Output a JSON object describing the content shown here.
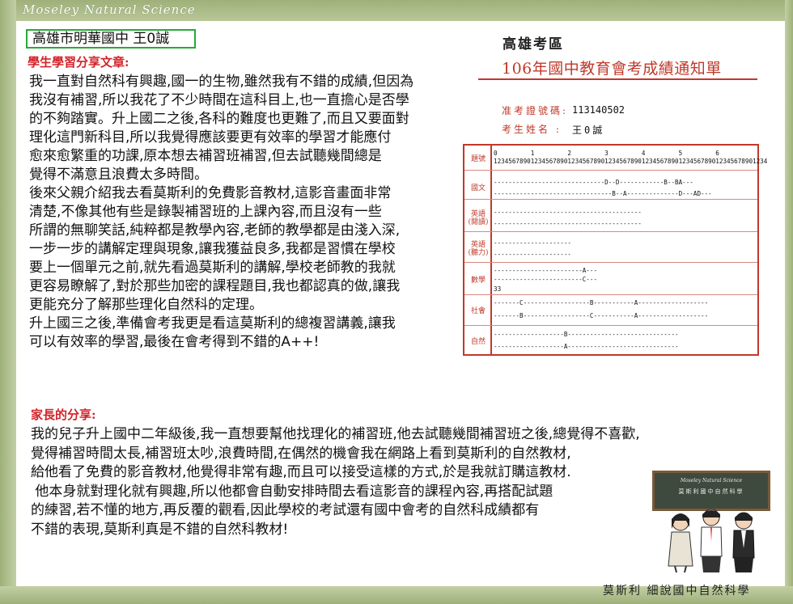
{
  "brand": "Moseley Natural Science",
  "student_name": "高雄市明華國中 王0誠",
  "student_section_title": "學生學習分享文章:",
  "student_text": "我一直對自然科有興趣,國一的生物,雖然我有不錯的成績,但因為\n我沒有補習,所以我花了不少時間在這科目上,也一直擔心是否學\n的不夠踏實。升上國二之後,各科的難度也更難了,而且又要面對\n理化這門新科目,所以我覺得應該要更有效率的學習才能應付\n愈來愈繁重的功課,原本想去補習班補習,但去試聽幾間總是\n覺得不滿意且浪費太多時間。\n後來父親介紹我去看莫斯利的免費影音教材,這影音畫面非常\n清楚,不像其他有些是錄製補習班的上課內容,而且沒有一些\n所謂的無聊笑話,純粹都是教學內容,老師的教學都是由淺入深,\n一步一步的講解定理與現象,讓我獲益良多,我都是習慣在學校\n要上一個單元之前,就先看過莫斯利的講解,學校老師教的我就\n更容易瞭解了,對於那些加密的課程題目,我也都認真的做,讓我\n更能充分了解那些理化自然科的定理。\n升上國三之後,準備會考我更是看這莫斯利的總複習講義,讓我\n可以有效率的學習,最後在會考得到不錯的A++!",
  "parent_section_title": "家長的分享:",
  "parent_text": "我的兒子升上國中二年級後,我一直想要幫他找理化的補習班,他去試聽幾間補習班之後,總覺得不喜歡,\n覺得補習時間太長,補習班太吵,浪費時間,在偶然的機會我在網路上看到莫斯利的自然教材,\n給他看了免費的影音教材,他覺得非常有趣,而且可以接受這樣的方式,於是我就訂購這教材.\n 他本身就對理化就有興趣,所以他都會自動安排時間去看這影音的課程內容,再搭配試題\n的練習,若不懂的地方,再反覆的觀看,因此學校的考試還有國中會考的自然科成績都有\n不錯的表現,莫斯利真是不錯的自然科教材!",
  "score_card": {
    "region": "高雄考區",
    "title": "106年國中教育會考成績通知單",
    "exam_id_label": "准考證號碼:",
    "exam_id": "113140502",
    "name_label": "考生姓名 :",
    "name": "王0誠",
    "header_label": "題號",
    "header_tens": "0         1         2         3         4         5         6",
    "header_digits": "12345678901234567890123456789012345678901234567890123456789012345678901234",
    "subjects": [
      {
        "label": "國文",
        "lines": [
          "------------------------------D--D------------B--BA---",
          "--------------------------------B--A--------------D---AD---"
        ]
      },
      {
        "label": "英語(閱讀)",
        "lines": [
          "----------------------------------------",
          "----------------------------------------"
        ]
      },
      {
        "label": "英語(聽力)",
        "lines": [
          "---------------------",
          "---------------------"
        ]
      },
      {
        "label": "數學",
        "lines": [
          "------------------------A---",
          "------------------------C---",
          "33"
        ]
      },
      {
        "label": "社會",
        "lines": [
          "-------C------------------B-----------A-------------------",
          "-------B------------------C-----------A-------------------"
        ]
      },
      {
        "label": "自然",
        "lines": [
          "-------------------B------------------------------",
          "-------------------A------------------------------"
        ]
      }
    ]
  },
  "illustration": {
    "board_line1": "Moseley Natural Science",
    "board_line2": "莫斯利國中自然科學"
  },
  "footer_label": "莫斯利 細說國中自然科學"
}
